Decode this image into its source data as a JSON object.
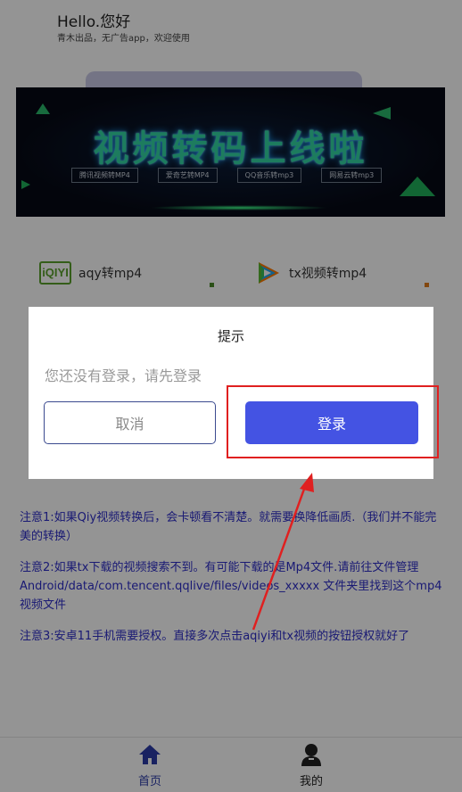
{
  "header": {
    "greeting": "Hello.您好",
    "subtitle": "青木出品，无广告app，欢迎使用"
  },
  "banner": {
    "title": "视频转码上线啦",
    "tags": [
      "腾讯视频转MP4",
      "爱奇艺转MP4",
      "QQ音乐转mp3",
      "网易云转mp3"
    ]
  },
  "features": {
    "iqiyi_logo_text": "iQIYI",
    "aqy_label": "aqy转mp4",
    "tx_label": "tx视频转mp4"
  },
  "notes": [
    "注意1:如果Qiy视频转换后，会卡顿看不清楚。就需要换降低画质.（我们并不能完美的转换）",
    "注意2:如果tx下载的视频搜索不到。有可能下载的是Mp4文件.请前往文件管理Android/data/com.tencent.qqlive/files/videos_xxxxx 文件夹里找到这个mp4视频文件",
    "注意3:安卓11手机需要授权。直接多次点击aqiyi和tx视频的按钮授权就好了"
  ],
  "tabbar": {
    "home_label": "首页",
    "mine_label": "我的",
    "home_color": "#2b3ba8",
    "mine_color": "#222222"
  },
  "dialog": {
    "title": "提示",
    "message": "您还没有登录，请先登录",
    "cancel_label": "取消",
    "login_label": "登录"
  },
  "colors": {
    "accent": "#4453e3",
    "note_text": "#2d2dc8",
    "highlight": "#e02020"
  },
  "icons": {
    "home": "home-icon",
    "mine": "user-icon"
  }
}
